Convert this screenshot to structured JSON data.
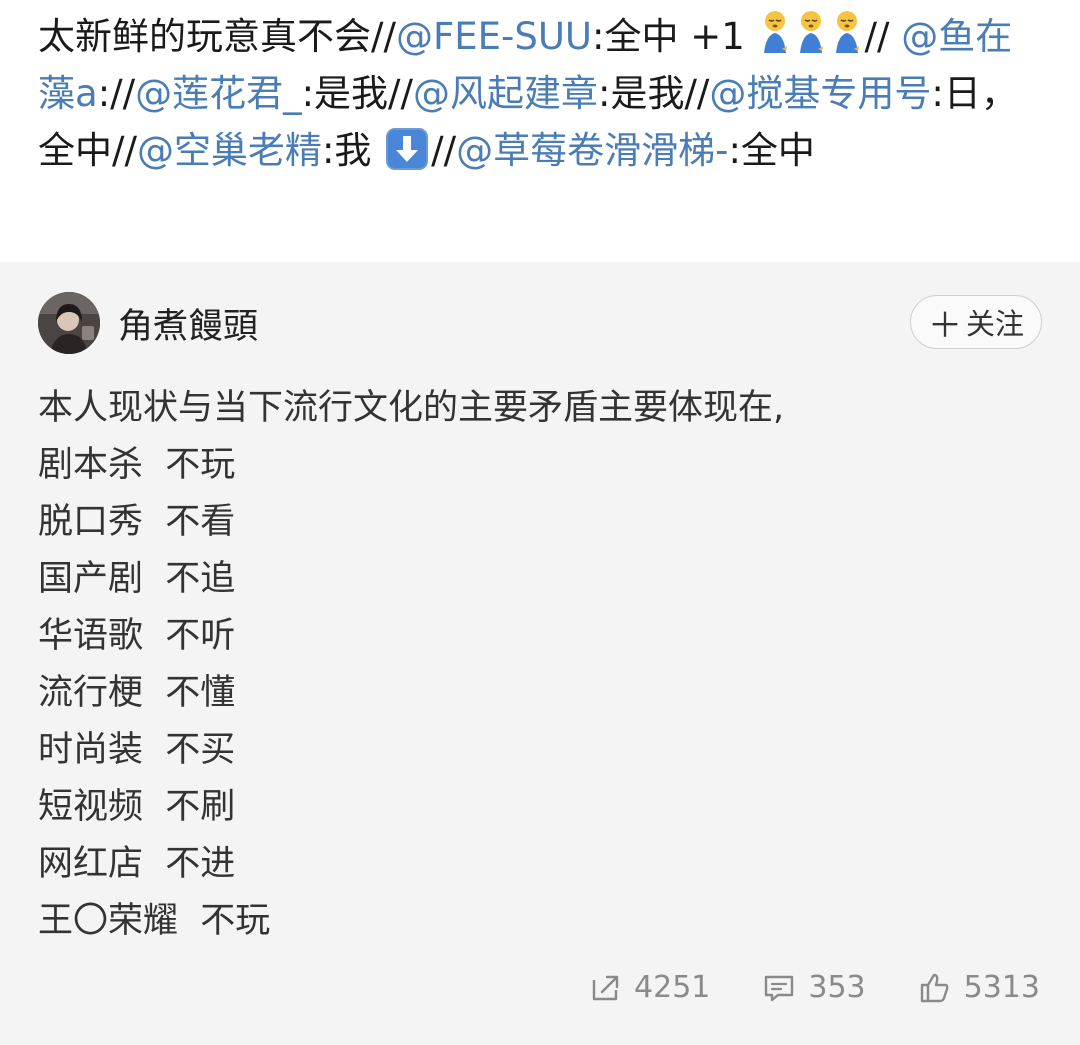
{
  "repost": {
    "seg_start": "太新鲜的玩意真不会//",
    "m1": "@FEE-SUU",
    "t1": ":全中 +1",
    "t_after_emoji": "//",
    "m2": "@鱼在藻a",
    "t2": "://",
    "m3": "@莲花君_",
    "t3": ":是我//",
    "m4": "@风起建章",
    "t4": ":是我//",
    "m5": "@搅基专用号",
    "t5": ":日，全中//",
    "m6": "@空巢老精",
    "t6": ":我",
    "t7": "//",
    "m7": "@草莓卷滑滑梯-",
    "t8": ":全中"
  },
  "post": {
    "author": "角煮饅頭",
    "follow_label": "关注",
    "lines": [
      "本人现状与当下流行文化的主要矛盾主要体现在,",
      "剧本杀  不玩",
      "脱口秀  不看",
      "国产剧  不追",
      "华语歌  不听",
      "流行梗  不懂",
      "时尚装  不买",
      "短视频  不刷",
      "网红店  不进",
      "王〇荣耀  不玩"
    ]
  },
  "actions": {
    "share_count": "4251",
    "comment_count": "353",
    "like_count": "5313"
  },
  "colors": {
    "mention": "#4a7db6",
    "panel_bg": "#f4f4f4"
  }
}
